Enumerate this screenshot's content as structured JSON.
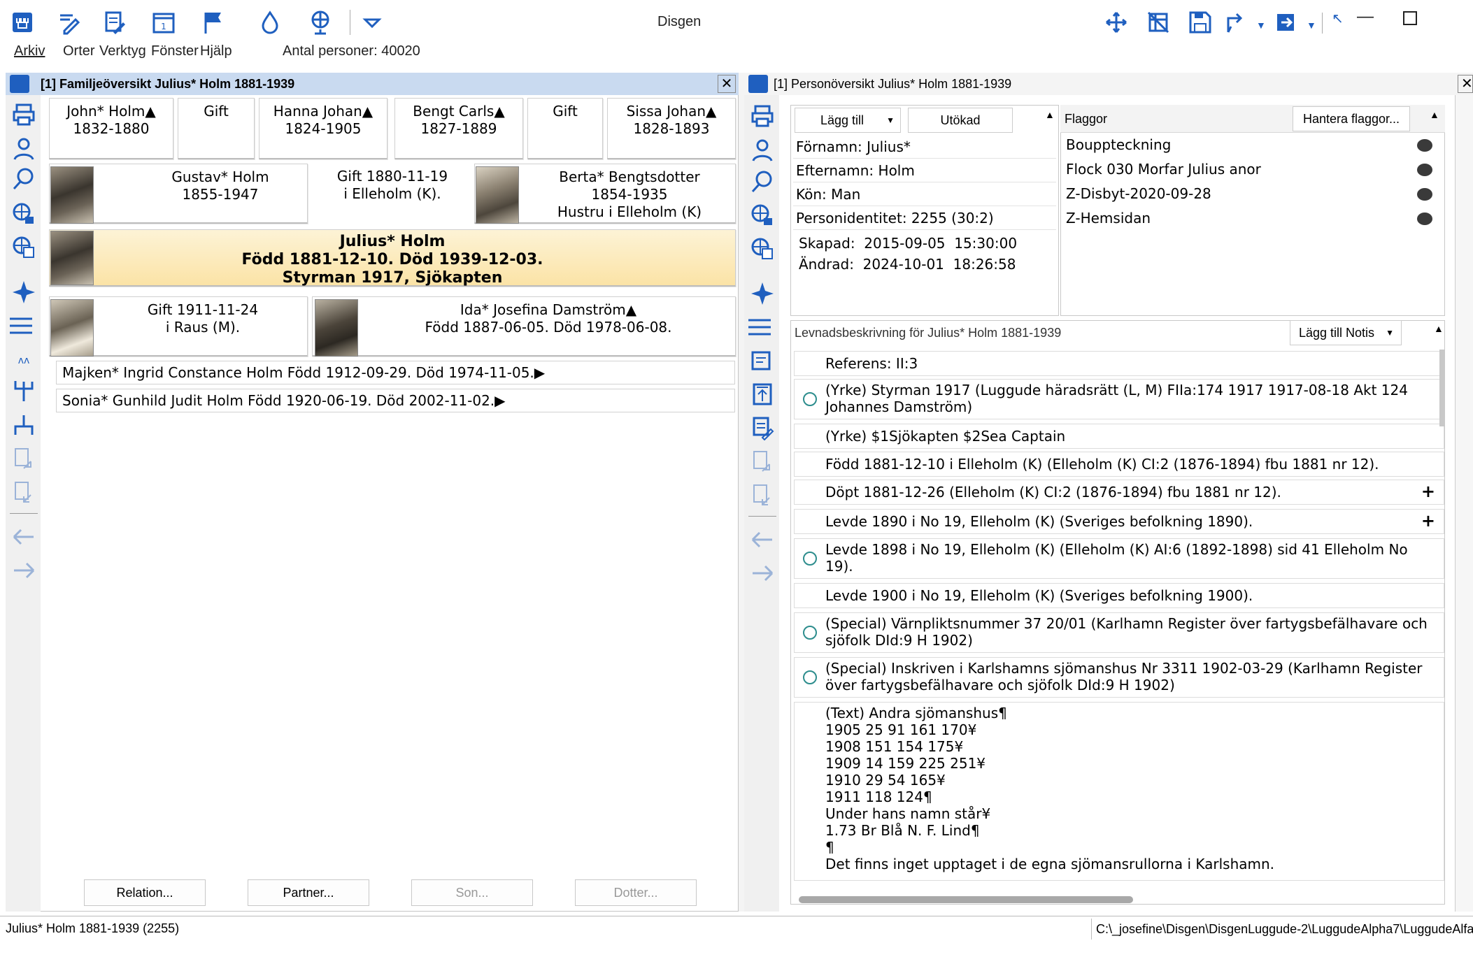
{
  "window": {
    "title": "Disgen"
  },
  "menu": {
    "items": [
      "Arkiv",
      "Orter",
      "Verktyg",
      "Fönster",
      "Hjälp"
    ],
    "person_count": "Antal personer: 40020"
  },
  "family_panel": {
    "title": "[1] Familjeöversikt Julius* Holm 1881-1939",
    "grandparents": [
      {
        "name": "John* Holm▲",
        "years": "1832-1880"
      },
      {
        "label": "Gift"
      },
      {
        "name": "Hanna Johan▲",
        "years": "1824-1905"
      },
      {
        "name": "Bengt Carls▲",
        "years": "1827-1889"
      },
      {
        "label": "Gift"
      },
      {
        "name": "Sissa Johan▲",
        "years": "1828-1893"
      }
    ],
    "father": {
      "name": "Gustav* Holm",
      "years": "1855-1947"
    },
    "parents_marriage": {
      "line1": "Gift 1880-11-19",
      "line2": "i Elleholm (K)."
    },
    "mother": {
      "name": "Berta* Bengtsdotter",
      "years": "1854-1935",
      "note": "Hustru  i Elleholm (K)"
    },
    "main": {
      "name": "Julius* Holm",
      "line2": "Född 1881-12-10. Död 1939-12-03.",
      "line3": "Styrman 1917, Sjökapten"
    },
    "marriage": {
      "line1": "Gift 1911-11-24",
      "line2": "i Raus (M)."
    },
    "spouse": {
      "name": "Ida* Josefina Damström▲",
      "line2": "Född 1887-06-05. Död 1978-06-08."
    },
    "children": [
      "Majken* Ingrid Constance Holm Född 1912-09-29. Död 1974-11-05.▶",
      "Sonia* Gunhild Judit Holm Född 1920-06-19. Död 2002-11-02.▶"
    ],
    "buttons": {
      "relation": "Relation...",
      "partner": "Partner...",
      "son": "Son...",
      "daughter": "Dotter..."
    }
  },
  "person_panel": {
    "title": "[1] Personöversikt Julius* Holm 1881-1939",
    "tabs": {
      "add": "Lägg till",
      "extended": "Utökad"
    },
    "fields": [
      "Förnamn: Julius*",
      "Efternamn: Holm",
      "Kön: Man",
      "Personidentitet: 2255 (30:2)"
    ],
    "created": "Skapad:  2015-09-05  15:30:00",
    "changed": "Ändrad:  2024-10-01  18:26:58",
    "flags_label": "Flaggor",
    "flags_button": "Hantera flaggor...",
    "flags": [
      "Bouppteckning",
      "Flock 030 Morfar Julius anor",
      "Z-Disbyt-2020-09-28",
      "Z-Hemsidan"
    ],
    "bio_title": "Levnadsbeskrivning för Julius* Holm 1881-1939",
    "bio_button": "Lägg till Notis",
    "events": [
      {
        "text": "Referens: II:3"
      },
      {
        "text": "(Yrke) Styrman 1917 (Luggude häradsrätt (L, M) FIIa:174 1917 1917-08-18 Akt 124 Johannes Damström)"
      },
      {
        "text": "(Yrke) $1Sjökapten $2Sea Captain"
      },
      {
        "text": "Född 1881-12-10 i Elleholm (K) (Elleholm (K) CI:2 (1876-1894) fbu 1881 nr 12)."
      },
      {
        "text": "Döpt 1881-12-26 (Elleholm (K) CI:2 (1876-1894) fbu 1881 nr 12)."
      },
      {
        "text": "Levde 1890 i No 19, Elleholm (K) (Sveriges befolkning 1890)."
      },
      {
        "text": "Levde 1898 i No 19, Elleholm (K) (Elleholm (K) AI:6 (1892-1898) sid 41 Elleholm No 19)."
      },
      {
        "text": "Levde 1900 i No 19, Elleholm (K) (Sveriges befolkning 1900)."
      },
      {
        "text": "(Special) Värnpliktsnummer 37 20/01 (Karlhamn Register över fartygsbefälhavare och sjöfolk DId:9 H 1902)"
      },
      {
        "text": "(Special) Inskriven i Karlshamns sjömanshus Nr 3311 1902-03-29 (Karlhamn Register över fartygsbefälhavare och sjöfolk DId:9 H 1902)"
      },
      {
        "lines": [
          "(Text) Andra sjömanshus¶",
          "1905 25 91 161 170¥",
          "1908 151 154 175¥",
          "1909 14 159 225 251¥",
          "1910 29 54 165¥",
          "1911 118 124¶",
          "Under hans namn står¥",
          "1.73 Br Blå N. F. Lind¶",
          "¶",
          "Det finns inget upptaget i de egna sjömansrullorna i Karlshamn."
        ]
      }
    ]
  },
  "status_bar": {
    "left": "Julius* Holm 1881-1939 (2255)",
    "right": "C:\\_josefine\\Disgen\\DisgenLuggude-2\\LuggudeAlpha7\\LuggudeAlfa"
  },
  "colors": {
    "panel_title_active": "#c9daf0",
    "main_person_bg": "#fbe9b8",
    "icon_blue": "#1f5fbf"
  }
}
